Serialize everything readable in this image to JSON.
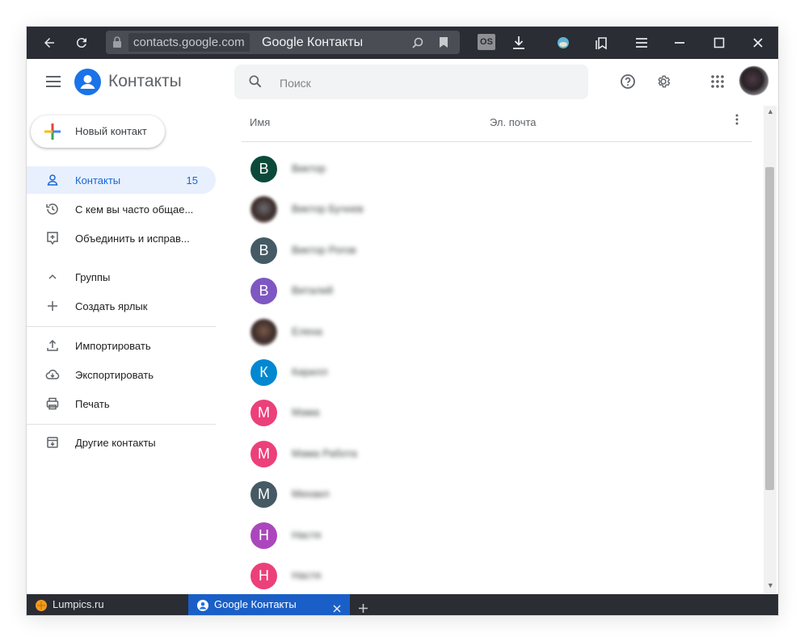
{
  "browser": {
    "url_host": "contacts.google.com",
    "page_title": "Google Контакты",
    "extension_badge": "OS"
  },
  "header": {
    "app_title": "Контакты",
    "search_placeholder": "Поиск"
  },
  "sidebar": {
    "new_contact_label": "Новый контакт",
    "items": [
      {
        "label": "Контакты",
        "count": "15",
        "icon": "person-icon"
      },
      {
        "label": "С кем вы часто общае...",
        "icon": "history-icon"
      },
      {
        "label": "Объединить и исправ...",
        "icon": "merge-icon"
      },
      {
        "label": "Группы",
        "icon": "chevron-up-icon"
      },
      {
        "label": "Создать ярлык",
        "icon": "plus-icon"
      },
      {
        "label": "Импортировать",
        "icon": "upload-icon"
      },
      {
        "label": "Экспортировать",
        "icon": "cloud-download-icon"
      },
      {
        "label": "Печать",
        "icon": "printer-icon"
      },
      {
        "label": "Другие контакты",
        "icon": "archive-icon"
      }
    ]
  },
  "list": {
    "col_name": "Имя",
    "col_email": "Эл. почта",
    "contacts": [
      {
        "initial": "В",
        "color": "#0b4a3a",
        "name": "Виктор"
      },
      {
        "initial": "",
        "color": "#6b6b70",
        "name": "Виктор Бучнев",
        "photo": true
      },
      {
        "initial": "В",
        "color": "#455a64",
        "name": "Виктор Рогов"
      },
      {
        "initial": "В",
        "color": "#7e57c2",
        "name": "Виталий"
      },
      {
        "initial": "",
        "color": "#7a5a4a",
        "name": "Елена",
        "photo": true
      },
      {
        "initial": "К",
        "color": "#0288d1",
        "name": "Кирилл"
      },
      {
        "initial": "М",
        "color": "#ec407a",
        "name": "Мама"
      },
      {
        "initial": "М",
        "color": "#ec407a",
        "name": "Мама Работа"
      },
      {
        "initial": "М",
        "color": "#455a64",
        "name": "Михаил"
      },
      {
        "initial": "Н",
        "color": "#ab47bc",
        "name": "Настя"
      },
      {
        "initial": "Н",
        "color": "#ec407a",
        "name": "Настя"
      }
    ]
  },
  "tabs": [
    {
      "label": "Lumpics.ru",
      "active": false
    },
    {
      "label": "Google Контакты",
      "active": true
    }
  ],
  "colors": {
    "accent": "#1a73e8",
    "active_nav_bg": "#e8f0fe",
    "active_nav_text": "#1967d2",
    "browser_chrome": "#2a2d33"
  }
}
